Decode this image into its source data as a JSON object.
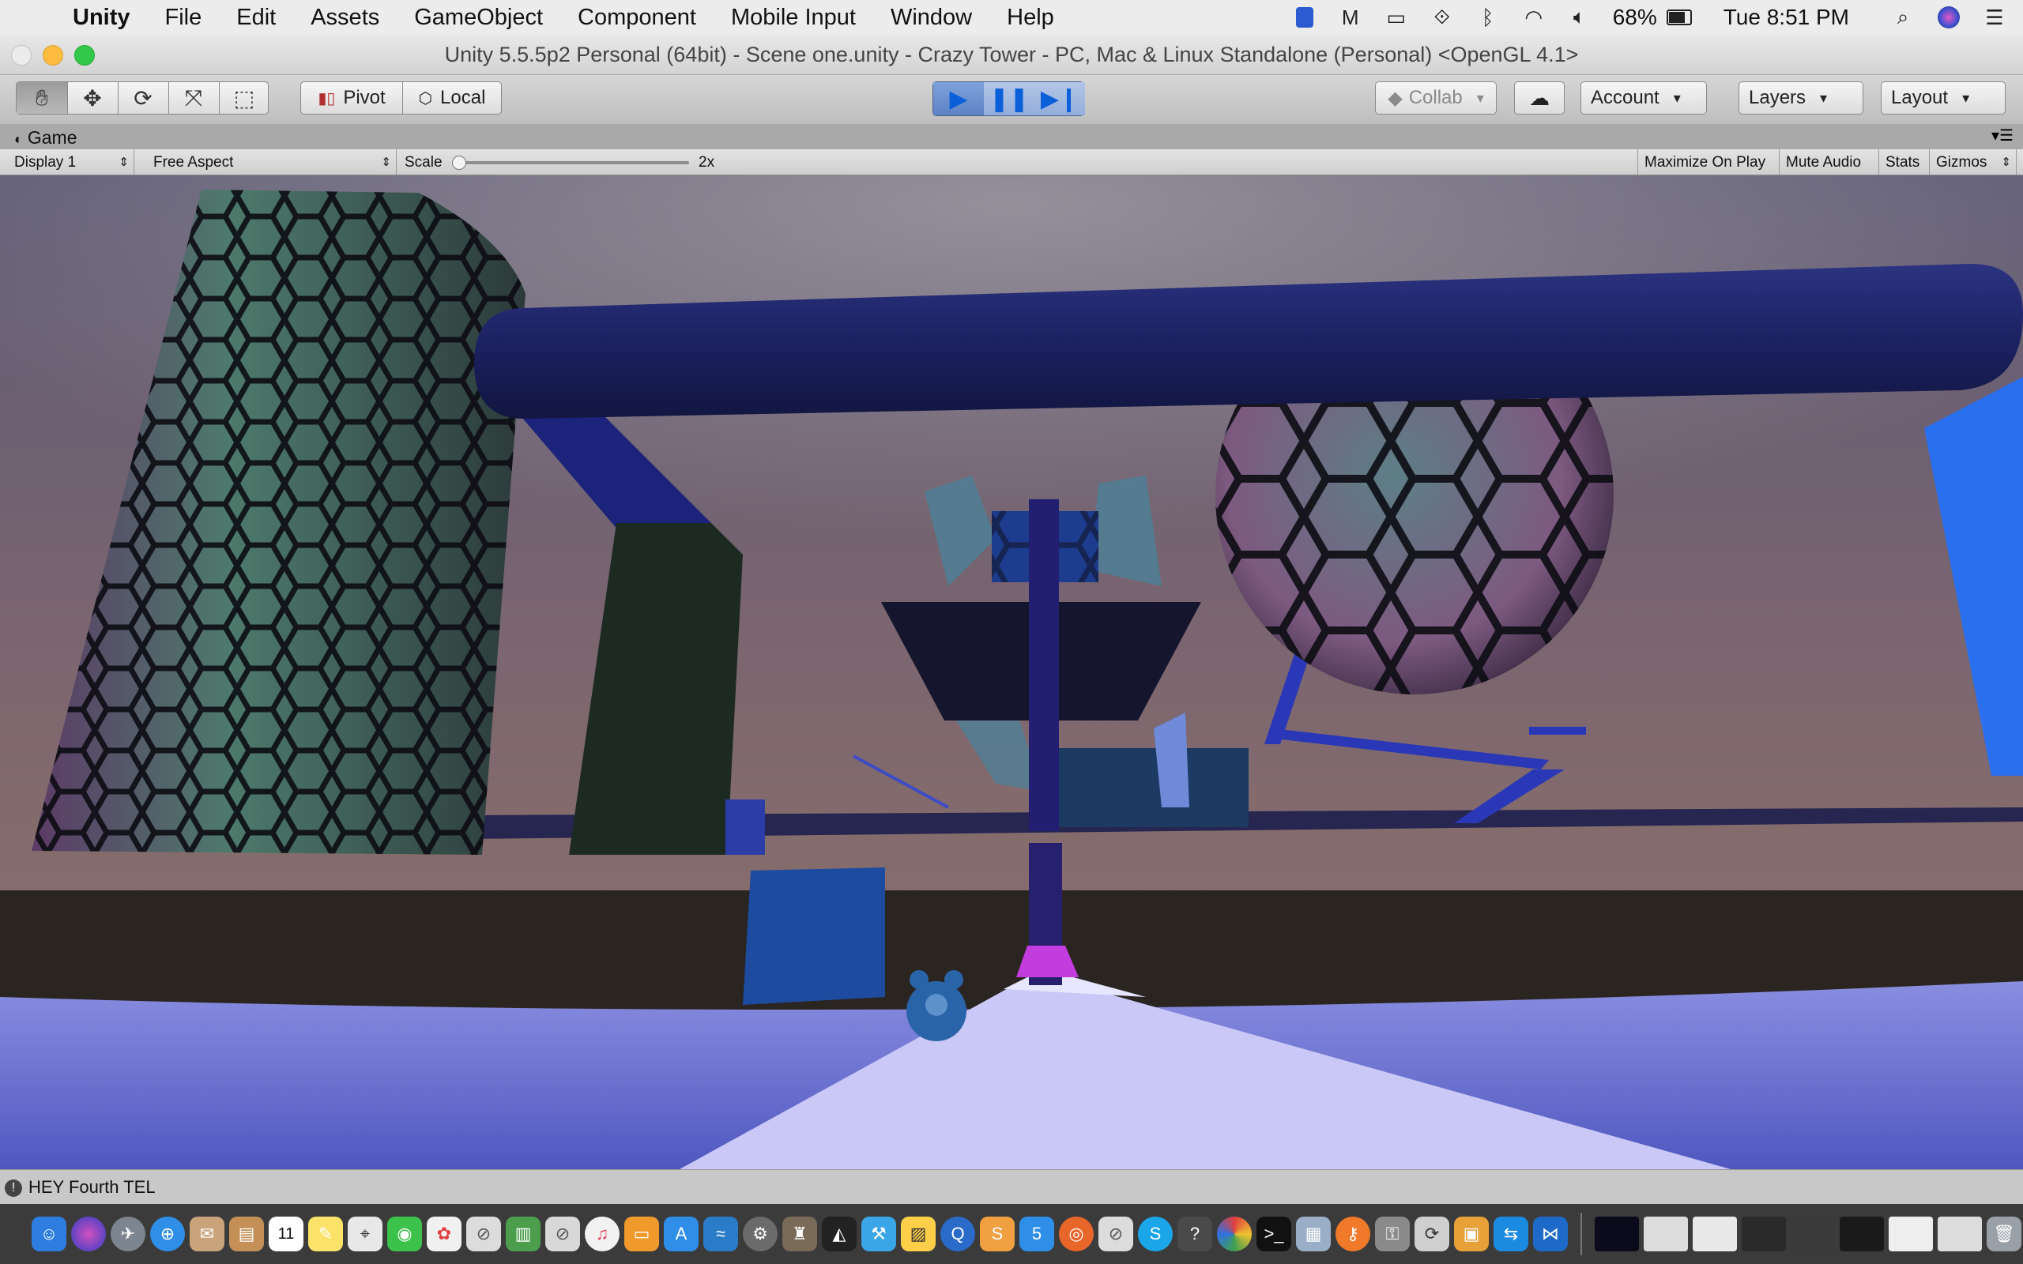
{
  "menubar": {
    "app_name": "Unity",
    "items": [
      "File",
      "Edit",
      "Assets",
      "GameObject",
      "Component",
      "Mobile Input",
      "Window",
      "Help"
    ],
    "battery": "68%",
    "clock": "Tue 8:51 PM"
  },
  "window": {
    "title": "Unity 5.5.5p2 Personal (64bit) - Scene one.unity - Crazy Tower - PC, Mac & Linux Standalone (Personal) <OpenGL 4.1>"
  },
  "toolbar": {
    "pivot_label": "Pivot",
    "local_label": "Local",
    "collab_label": "Collab",
    "account_label": "Account",
    "layers_label": "Layers",
    "layout_label": "Layout"
  },
  "game_view": {
    "tab_label": "Game",
    "display": "Display 1",
    "aspect": "Free Aspect",
    "scale_label": "Scale",
    "scale_value": "2x",
    "maximize_label": "Maximize On Play",
    "mute_label": "Mute Audio",
    "stats_label": "Stats",
    "gizmos_label": "Gizmos"
  },
  "status": {
    "message": "HEY Fourth TEL"
  },
  "dock": {
    "calendar_day": "11"
  },
  "colors": {
    "play_active": "#3a7be0",
    "sky_top": "#5c5a74",
    "floor": "#6a6fd6",
    "tube": "#1f2466"
  }
}
